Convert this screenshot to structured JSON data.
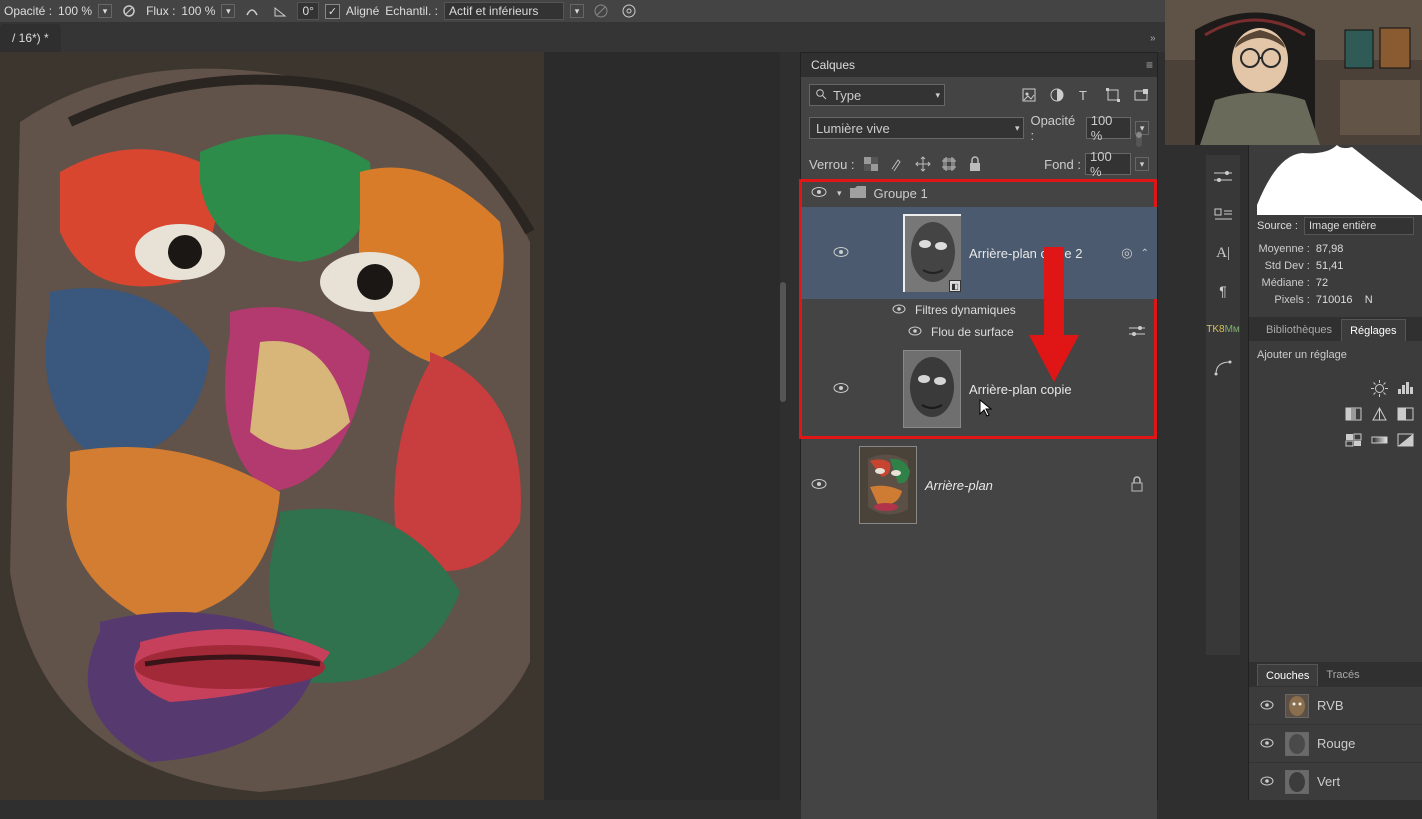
{
  "options_bar": {
    "opacity_label": "Opacité :",
    "opacity_value": "100 %",
    "flow_label": "Flux :",
    "flow_value": "100 %",
    "angle_value": "0°",
    "aligned_label": "Aligné",
    "sample_label": "Echantil. :",
    "sample_value": "Actif et inférieurs"
  },
  "document_tab": "/ 16*) *",
  "layers_panel": {
    "title": "Calques",
    "type_label": "Type",
    "blend_mode": "Lumière vive",
    "opacity_label": "Opacité :",
    "opacity_value": "100 %",
    "lock_label": "Verrou :",
    "fill_label": "Fond :",
    "fill_value": "100 %",
    "group": {
      "name": "Groupe 1",
      "children": [
        {
          "name": "Arrière-plan copie 2",
          "smart_filters_label": "Filtres dynamiques",
          "filter_name": "Flou de surface"
        },
        {
          "name": "Arrière-plan copie"
        }
      ]
    },
    "bg_layer": "Arrière-plan"
  },
  "histogram_panel": {
    "source_label": "Source :",
    "source_value": "Image entière",
    "stats": {
      "mean_label": "Moyenne :",
      "mean_value": "87,98",
      "stddev_label": "Std Dev :",
      "stddev_value": "51,41",
      "median_label": "Médiane :",
      "median_value": "72",
      "pixels_label": "Pixels :",
      "pixels_value": "710016",
      "n_label": "N"
    }
  },
  "right_strip_icons": [
    "sliders-icon",
    "levels-icon",
    "ai-icon",
    "paragraph-icon",
    "tk8-icon",
    "curve-icon"
  ],
  "adjustments_panel": {
    "tab_libraries": "Bibliothèques",
    "tab_adjustments": "Réglages",
    "add_label": "Ajouter un réglage"
  },
  "channels_panel": {
    "tab_channels": "Couches",
    "tab_paths": "Tracés",
    "items": [
      {
        "name": "RVB"
      },
      {
        "name": "Rouge"
      },
      {
        "name": "Vert"
      }
    ]
  }
}
